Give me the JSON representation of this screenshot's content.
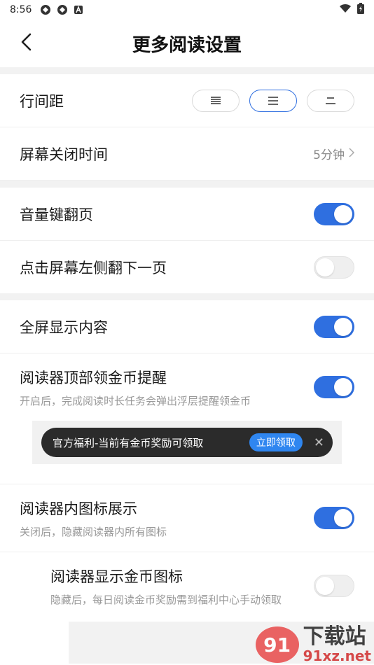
{
  "status_bar": {
    "time": "8:56"
  },
  "header": {
    "title": "更多阅读设置"
  },
  "line_spacing": {
    "label": "行间距",
    "options": [
      "≣",
      "☰",
      "二"
    ],
    "selected_index": 1
  },
  "screen_off": {
    "label": "屏幕关闭时间",
    "value": "5分钟"
  },
  "volume_key": {
    "label": "音量键翻页",
    "on": true
  },
  "tap_left": {
    "label": "点击屏幕左侧翻下一页",
    "on": false
  },
  "fullscreen": {
    "label": "全屏显示内容",
    "on": true
  },
  "coin_reminder": {
    "label": "阅读器顶部领金币提醒",
    "desc": "开启后，完成阅读时长任务会弹出浮层提醒领金币",
    "on": true
  },
  "banner": {
    "text": "官方福利-当前有金币奖励可领取",
    "button": "立即领取",
    "close": "✕"
  },
  "icon_display": {
    "label": "阅读器内图标展示",
    "desc": "关闭后，隐藏阅读器内所有图标",
    "on": true
  },
  "coin_icon": {
    "label": "阅读器显示金币图标",
    "desc": "隐藏后，每日阅读金币奖励需到福利中心手动领取",
    "on": false
  },
  "watermark": {
    "badge": "91",
    "cn": "下载站",
    "en": "91xz.net"
  },
  "colors": {
    "accent": "#2f6fe0",
    "banner_button": "#2f86f0"
  }
}
